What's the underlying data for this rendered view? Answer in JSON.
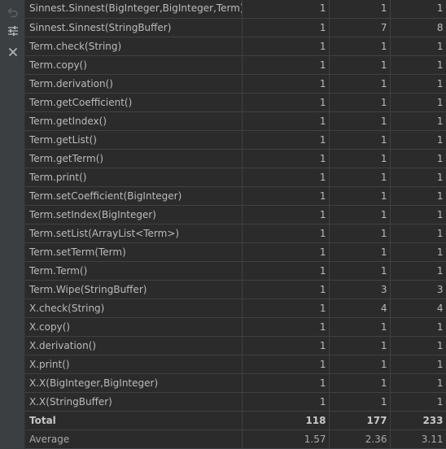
{
  "toolbar": {
    "icons": [
      "undo-icon",
      "settings-sliders-icon",
      "close-icon"
    ],
    "colors": {
      "active": "#afb1b3",
      "disabled": "#5c5f61"
    }
  },
  "table": {
    "rows": [
      {
        "method": "Sinnest.Sinnest(BigInteger,BigInteger,Term)",
        "v1": "1",
        "v2": "1",
        "v3": "1"
      },
      {
        "method": "Sinnest.Sinnest(StringBuffer)",
        "v1": "1",
        "v2": "7",
        "v3": "8"
      },
      {
        "method": "Term.check(String)",
        "v1": "1",
        "v2": "1",
        "v3": "1"
      },
      {
        "method": "Term.copy()",
        "v1": "1",
        "v2": "1",
        "v3": "1"
      },
      {
        "method": "Term.derivation()",
        "v1": "1",
        "v2": "1",
        "v3": "1"
      },
      {
        "method": "Term.getCoefficient()",
        "v1": "1",
        "v2": "1",
        "v3": "1"
      },
      {
        "method": "Term.getIndex()",
        "v1": "1",
        "v2": "1",
        "v3": "1"
      },
      {
        "method": "Term.getList()",
        "v1": "1",
        "v2": "1",
        "v3": "1"
      },
      {
        "method": "Term.getTerm()",
        "v1": "1",
        "v2": "1",
        "v3": "1"
      },
      {
        "method": "Term.print()",
        "v1": "1",
        "v2": "1",
        "v3": "1"
      },
      {
        "method": "Term.setCoefficient(BigInteger)",
        "v1": "1",
        "v2": "1",
        "v3": "1"
      },
      {
        "method": "Term.setIndex(BigInteger)",
        "v1": "1",
        "v2": "1",
        "v3": "1"
      },
      {
        "method": "Term.setList(ArrayList<Term>)",
        "v1": "1",
        "v2": "1",
        "v3": "1"
      },
      {
        "method": "Term.setTerm(Term)",
        "v1": "1",
        "v2": "1",
        "v3": "1"
      },
      {
        "method": "Term.Term()",
        "v1": "1",
        "v2": "1",
        "v3": "1"
      },
      {
        "method": "Term.Wipe(StringBuffer)",
        "v1": "1",
        "v2": "3",
        "v3": "3"
      },
      {
        "method": "X.check(String)",
        "v1": "1",
        "v2": "4",
        "v3": "4"
      },
      {
        "method": "X.copy()",
        "v1": "1",
        "v2": "1",
        "v3": "1"
      },
      {
        "method": "X.derivation()",
        "v1": "1",
        "v2": "1",
        "v3": "1"
      },
      {
        "method": "X.print()",
        "v1": "1",
        "v2": "1",
        "v3": "1"
      },
      {
        "method": "X.X(BigInteger,BigInteger)",
        "v1": "1",
        "v2": "1",
        "v3": "1"
      },
      {
        "method": "X.X(StringBuffer)",
        "v1": "1",
        "v2": "1",
        "v3": "1"
      }
    ],
    "total": {
      "label": "Total",
      "v1": "118",
      "v2": "177",
      "v3": "233"
    },
    "average": {
      "label": "Average",
      "v1": "1.57",
      "v2": "2.36",
      "v3": "3.11"
    }
  }
}
